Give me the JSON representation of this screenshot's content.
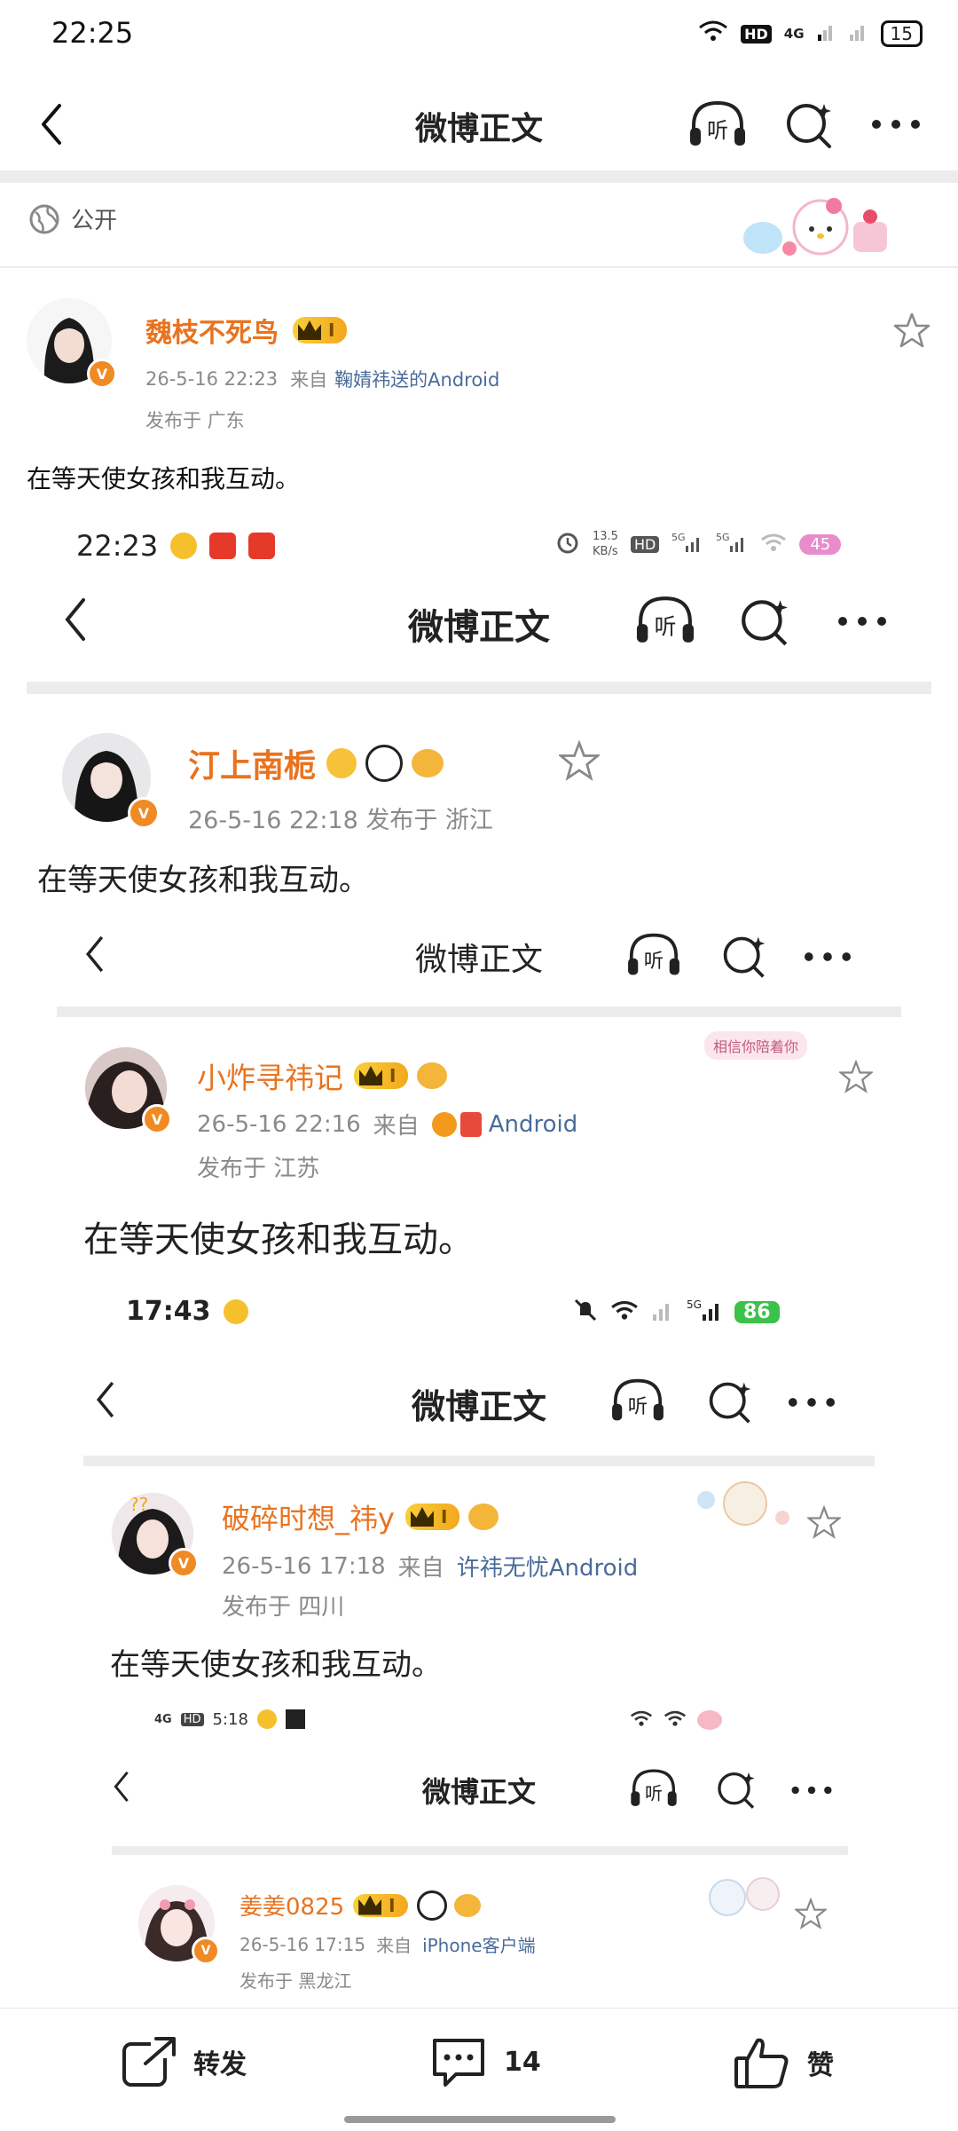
{
  "status_bar": {
    "time": "22:25",
    "battery": "15",
    "network": "4G",
    "hd": "HD"
  },
  "header": {
    "title": "微博正文"
  },
  "visibility": {
    "label": "公开"
  },
  "post": {
    "author": "魏枝不死鸟",
    "level": "I",
    "date": "26-5-16 22:23",
    "source_prefix": "来自",
    "source": "鞠婧祎送的Android",
    "location": "发布于 广东",
    "text": "在等天使女孩和我互动。"
  },
  "screenshot_1": {
    "status": {
      "time": "22:23",
      "speed_top": "13.5",
      "speed_unit": "KB/s",
      "battery": "45"
    },
    "header_title": "微博正文",
    "author": "汀上南栀",
    "meta": "26-5-16 22:18  发布于 浙江",
    "text": "在等天使女孩和我互动。"
  },
  "screenshot_2": {
    "header_title": "微博正文",
    "author": "小炸寻祎记",
    "level": "I",
    "date": "26-5-16 22:16",
    "source_prefix": "来自",
    "source": "Android",
    "location": "发布于 江苏",
    "text": "在等天使女孩和我互动。",
    "sticker_text": "相信你陪着你"
  },
  "screenshot_3": {
    "status": {
      "time": "17:43",
      "battery": "86"
    },
    "header_title": "微博正文",
    "author": "破碎时想_祎y",
    "level": "I",
    "date": "26-5-16 17:18",
    "source_prefix": "来自",
    "source": "许祎无忧Android",
    "location": "发布于 四川",
    "text": "在等天使女孩和我互动。"
  },
  "screenshot_4": {
    "status": {
      "time": "5:18",
      "net": "4G"
    },
    "header_title": "微博正文",
    "author": "姜姜0825",
    "level": "I",
    "date": "26-5-16 17:15",
    "source_prefix": "来自",
    "source": "iPhone客户端",
    "location": "发布于 黑龙江"
  },
  "bottom_bar": {
    "repost": "转发",
    "comment_count": "14",
    "like": "赞"
  },
  "colors": {
    "accent": "#e8731f",
    "link": "#4a6b9a",
    "vip_gold": "#f3b11c"
  }
}
